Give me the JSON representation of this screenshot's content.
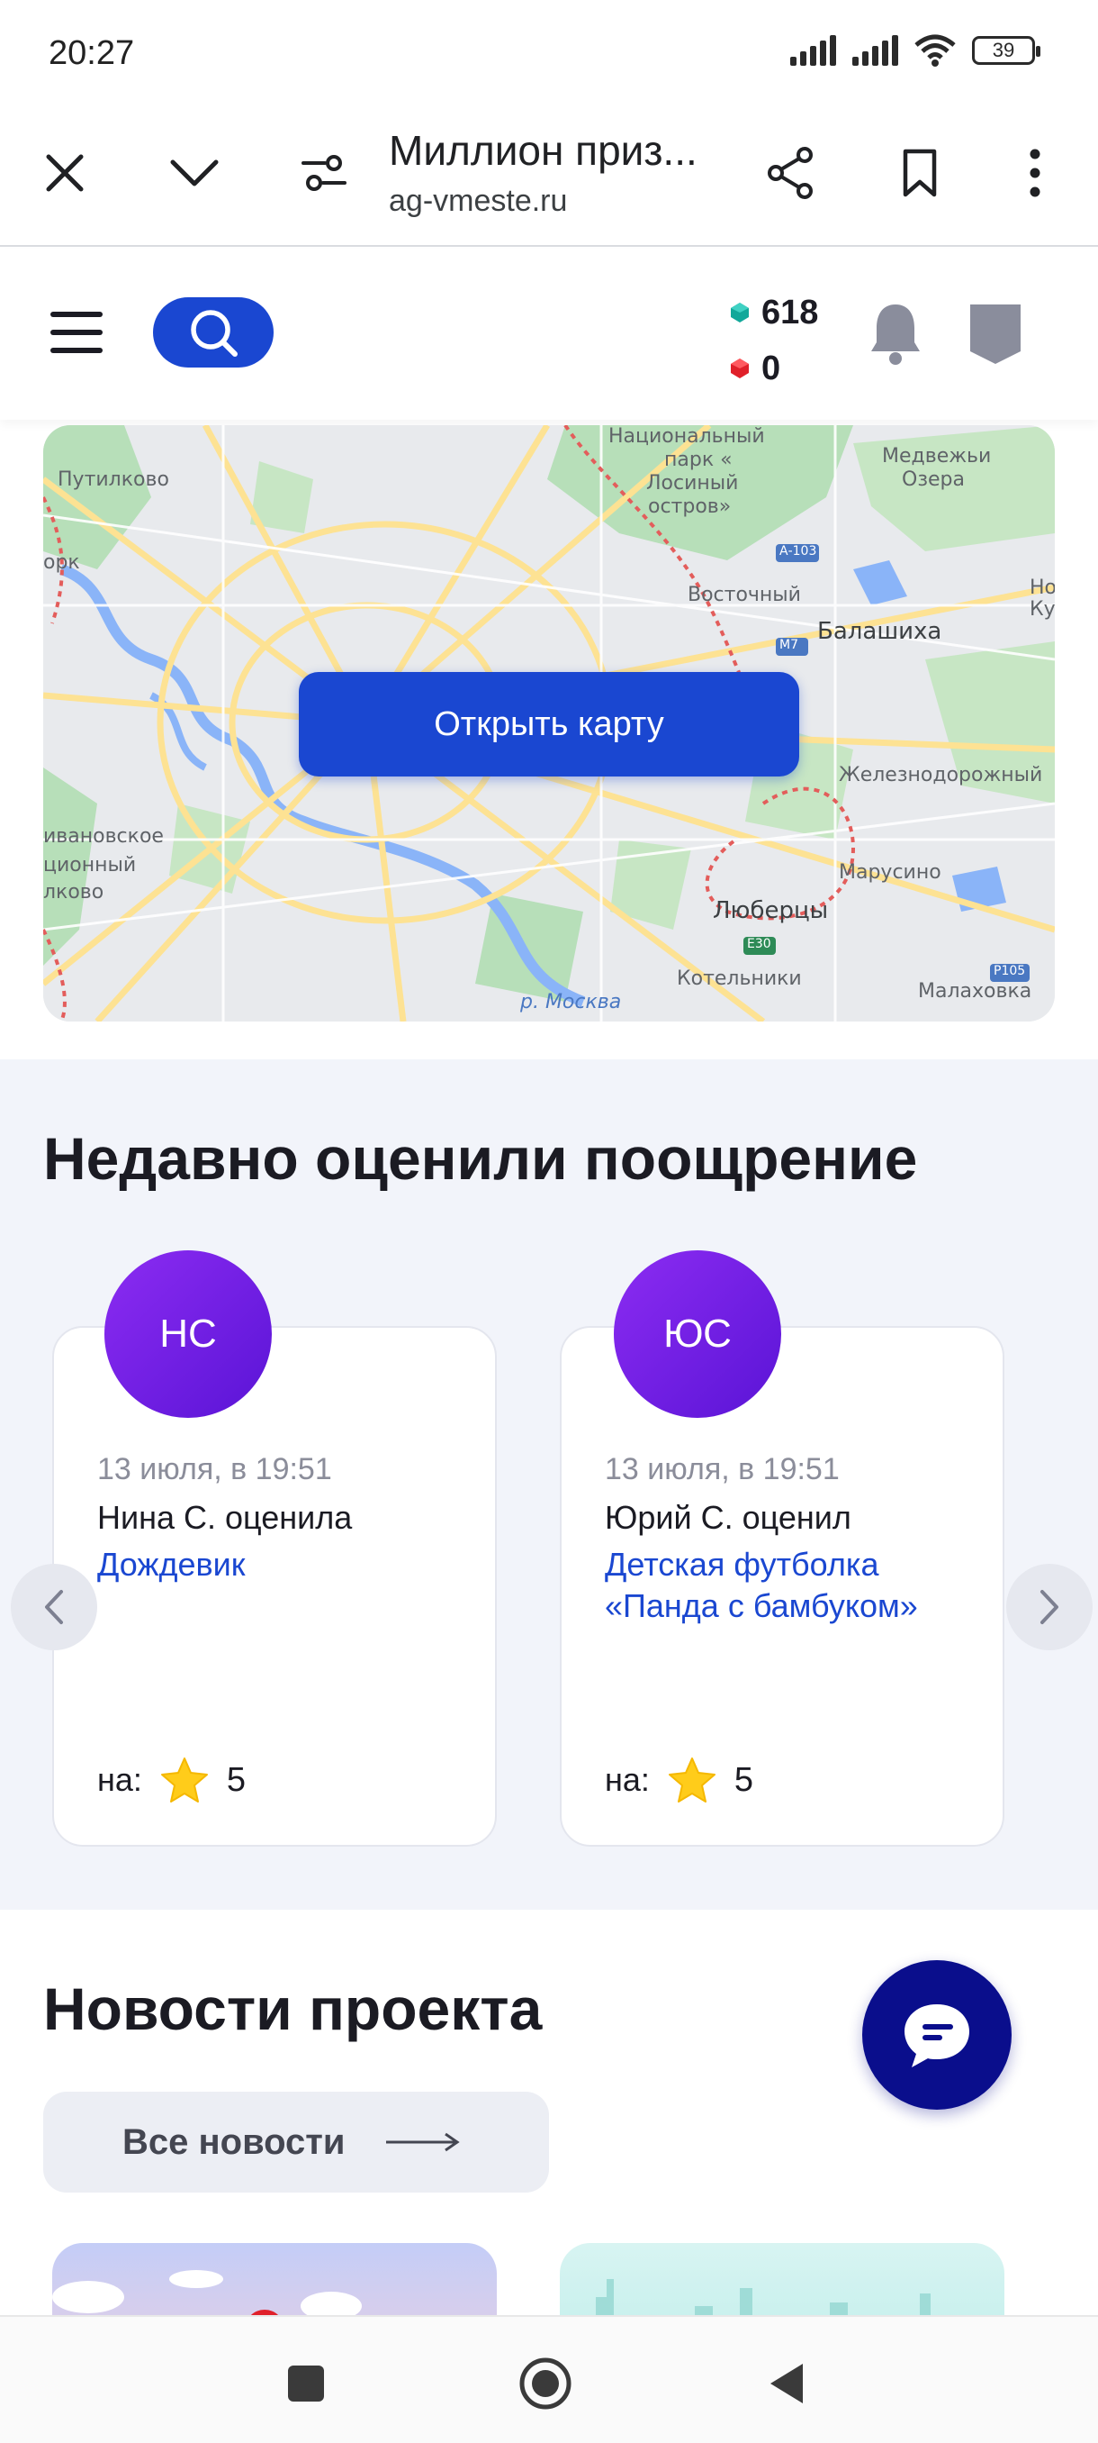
{
  "status_bar": {
    "time": "20:27",
    "battery": "39"
  },
  "browser": {
    "title": "Миллион приз...",
    "url": "ag-vmeste.ru"
  },
  "header": {
    "balance_green": "618",
    "balance_red": "0"
  },
  "map": {
    "button_label": "Открыть карту",
    "labels": {
      "park": "Национальный парк «Лосиный остров»",
      "park_l1": "Национальный",
      "park_l2": "парк «",
      "park_l3": "Лосиный",
      "park_l4": "остров»",
      "medvezhi": "Медвежьи",
      "ozera": "Озера",
      "putilkovo": "Путилково",
      "a103": "А-103",
      "vostochny": "Восточный",
      "m7": "М7",
      "balashikha": "Балашиха",
      "zheleznodorozhny": "Железнодорожный",
      "ivanovskoe": "ивановское",
      "marusino": "Марусино",
      "lyubertsy": "Люберцы",
      "e30": "Е30",
      "kotelniki": "Котельники",
      "malakhovka": "Малаховка",
      "p105": "Р105",
      "moskva_river": "р. Москва",
      "tsionny": "ционный",
      "lkovo": "лково",
      "ork": "орк",
      "ku": "Ку",
      "no": "Но"
    }
  },
  "reviews": {
    "title": "Недавно оценили поощрение",
    "cards": [
      {
        "initials": "НС",
        "date": "13 июля, в 19:51",
        "who": "Нина С. оценила",
        "item": "Дождевик",
        "rate_label": "на:",
        "rating": "5"
      },
      {
        "initials": "ЮС",
        "date": "13 июля, в 19:51",
        "who": "Юрий С. оценил",
        "item": "Детская футболка «Панда с бамбуком»",
        "rate_label": "на:",
        "rating": "5"
      }
    ]
  },
  "news": {
    "title": "Новости проекта",
    "all_news_label": "Все новости"
  },
  "colors": {
    "primary": "#1a47d1",
    "avatar_gradient_start": "#8c2cf2",
    "avatar_gradient_end": "#5a14d6",
    "fab": "#0a0e8c",
    "section_bg": "#f2f4fa"
  }
}
